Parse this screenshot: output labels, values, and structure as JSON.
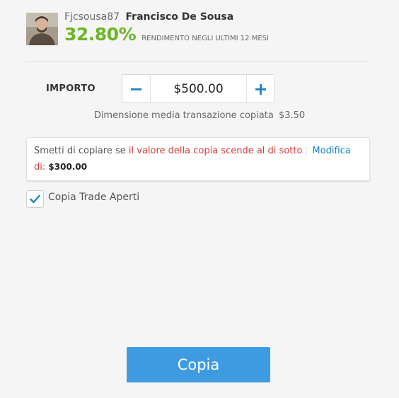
{
  "trader": {
    "username": "Fjcsousa87",
    "full_name": "Francisco De Sousa",
    "gain": "32.80%",
    "gain_label": "RENDIMENTO NEGLI ULTIMI 12 MESI",
    "gain_color": "#6cb527"
  },
  "amount": {
    "label": "IMPORTO",
    "value": "$500.00",
    "minus_symbol": "−",
    "plus_symbol": "+"
  },
  "average": {
    "text": "Dimensione media transazione copiata",
    "value": "$3.50"
  },
  "stop_loss": {
    "prefix": "Smetti di copiare se",
    "red_text": "il valore della copia scende al di sotto",
    "red_text_2": "di:",
    "amount": "$300.00",
    "edit_label": "Modifica"
  },
  "copy_open_trades": {
    "label": "Copia Trade Aperti",
    "checked": true
  },
  "copy_button": {
    "label": "Copia",
    "color": "#3d9be2"
  },
  "icons": [
    "avatar",
    "minus-icon",
    "plus-icon",
    "check-icon"
  ]
}
